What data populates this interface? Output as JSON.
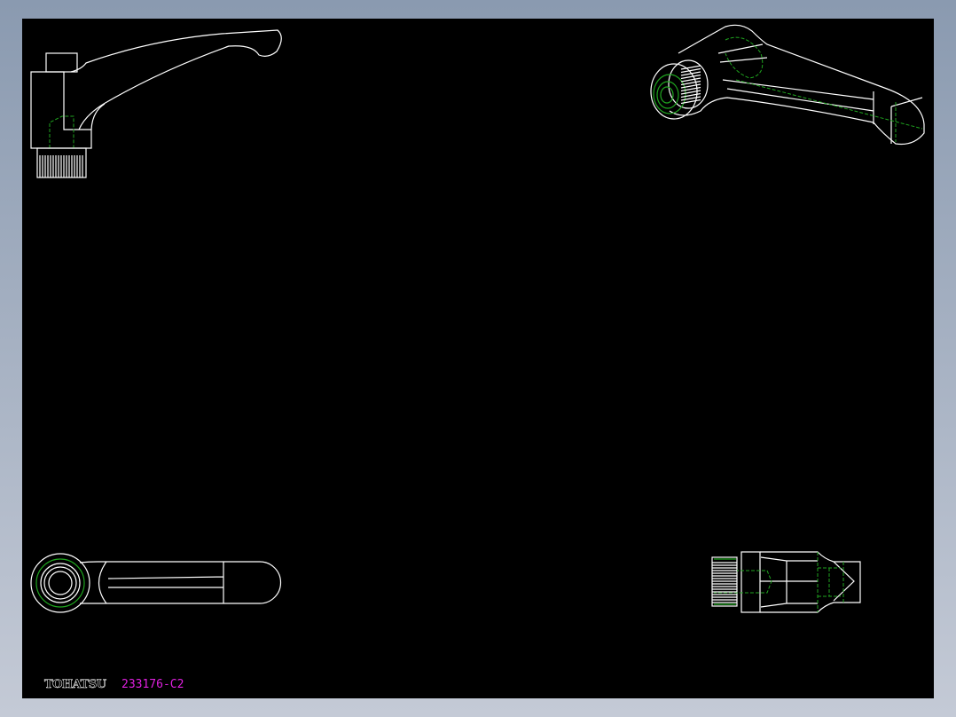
{
  "drawing": {
    "brand": "TOHATSU",
    "part_number": "233176-C2",
    "colors": {
      "background": "#000000",
      "lines": "#ffffff",
      "hidden_lines": "#1fa51f",
      "part_number": "#e020e0"
    }
  }
}
